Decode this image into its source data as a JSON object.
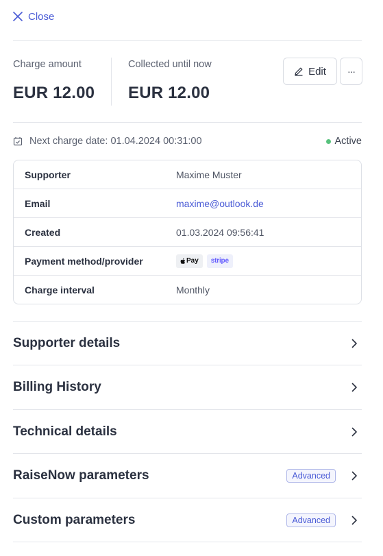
{
  "header": {
    "close_label": "Close"
  },
  "summary": {
    "charge_amount_label": "Charge amount",
    "charge_amount_value": "EUR 12.00",
    "collected_label": "Collected until now",
    "collected_value": "EUR 12.00"
  },
  "actions": {
    "edit_label": "Edit",
    "more_label": "···"
  },
  "schedule": {
    "next_charge": "Next charge date: 01.04.2024 00:31:00"
  },
  "status": {
    "label": "Active",
    "color": "#58c27d"
  },
  "details": [
    {
      "key": "Supporter",
      "value": "Maxime Muster"
    },
    {
      "key": "Email",
      "value": "maxime@outlook.de"
    },
    {
      "key": "Created",
      "value": "01.03.2024 09:56:41"
    },
    {
      "key": "Payment method/provider",
      "badges": [
        "Pay",
        "stripe"
      ]
    },
    {
      "key": "Charge interval",
      "value": "Monthly"
    }
  ],
  "sections": [
    {
      "title": "Supporter details"
    },
    {
      "title": "Billing History"
    },
    {
      "title": "Technical details"
    },
    {
      "title": "RaiseNow parameters",
      "badge": "Advanced"
    },
    {
      "title": "Custom parameters",
      "badge": "Advanced"
    }
  ],
  "colors": {
    "accent": "#4a5bd6",
    "text": "#2b3140",
    "muted": "#5b6170"
  }
}
